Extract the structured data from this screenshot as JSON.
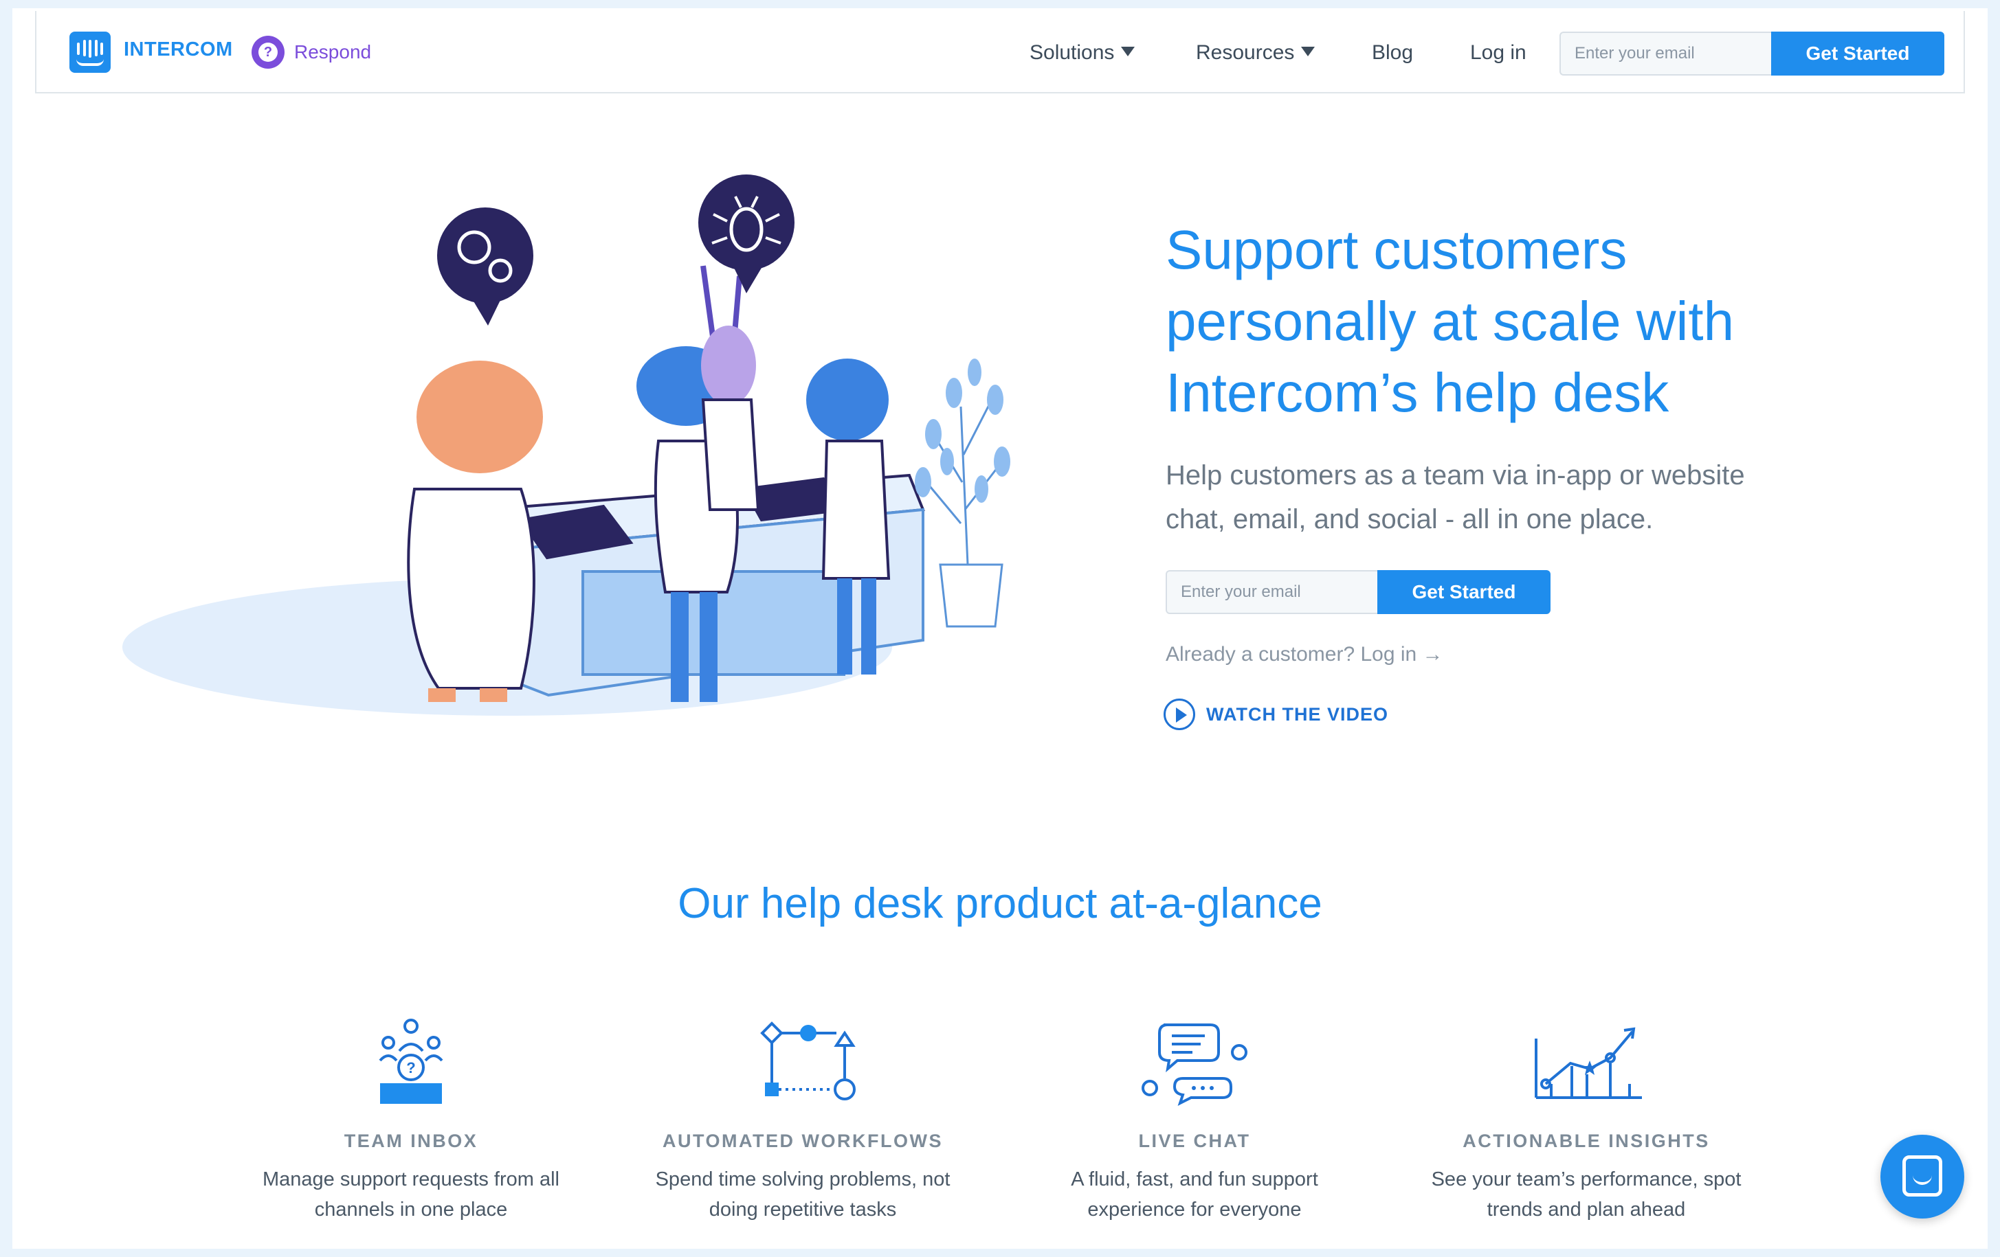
{
  "header": {
    "brand": "INTERCOM",
    "product": "Respond",
    "product_icon_glyph": "?",
    "nav": [
      {
        "label": "Solutions",
        "has_dropdown": true
      },
      {
        "label": "Resources",
        "has_dropdown": true
      },
      {
        "label": "Blog",
        "has_dropdown": false
      },
      {
        "label": "Log in",
        "has_dropdown": false
      }
    ],
    "email_placeholder": "Enter your email",
    "cta_label": "Get Started"
  },
  "hero": {
    "title_lines": [
      "Support customers",
      "personally at scale with",
      "Intercom’s help desk"
    ],
    "subtitle_lines": [
      "Help customers as a team via in-app or website",
      "chat, email, and social - all in one place."
    ],
    "email_placeholder": "Enter your email",
    "cta_label": "Get Started",
    "login_link": "Already a customer? Log in →",
    "video_label": "WATCH THE VIDEO"
  },
  "section": {
    "title": "Our help desk product at-a-glance",
    "features": [
      {
        "icon": "team-inbox-icon",
        "title": "TEAM INBOX",
        "desc_lines": [
          "Manage support requests from all",
          "channels in one place"
        ]
      },
      {
        "icon": "workflows-icon",
        "title": "AUTOMATED WORKFLOWS",
        "desc_lines": [
          "Spend time solving problems, not",
          "doing repetitive tasks"
        ]
      },
      {
        "icon": "live-chat-icon",
        "title": "LIVE CHAT",
        "desc_lines": [
          "A fluid, fast, and fun support",
          "experience for everyone"
        ]
      },
      {
        "icon": "insights-icon",
        "title": "ACTIONABLE INSIGHTS",
        "desc_lines": [
          "See your team’s performance, spot",
          "trends and plan ahead"
        ]
      }
    ]
  },
  "colors": {
    "brand_blue": "#1f8ded",
    "respond_purple": "#7b4ddb",
    "text_dark": "#3c4b5a",
    "text_muted": "#6b7885",
    "page_frame": "#e9f3fc"
  },
  "messenger_icon": "messenger-icon"
}
